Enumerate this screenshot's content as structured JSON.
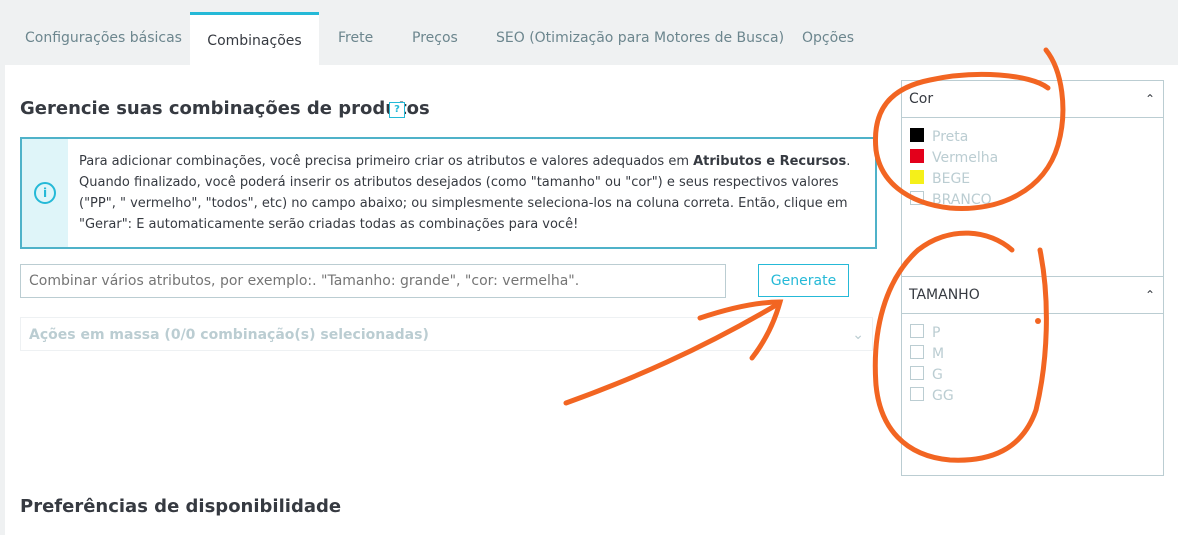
{
  "tabs": [
    {
      "label": "Configurações básicas"
    },
    {
      "label": "Combinações"
    },
    {
      "label": "Frete"
    },
    {
      "label": "Preços"
    },
    {
      "label": "SEO (Otimização para Motores de Busca)"
    },
    {
      "label": "Opções"
    }
  ],
  "main": {
    "title": "Gerencie suas combinações de produtos",
    "help_icon": "?",
    "alert": {
      "icon": "i",
      "text_before": "Para adicionar combinações, você precisa primeiro criar os atributos e valores adequados em ",
      "bold": "Atributos e Recursos",
      "text_after": ". Quando finalizado, você poderá inserir os atributos desejados (como \"tamanho\" ou \"cor\") e seus respectivos valores (\"PP\", \" vermelho\", \"todos\", etc) no campo abaixo; ou simplesmente seleciona-los na coluna correta. Então, clique em \"Gerar\": E automaticamente serão criadas todas as combinações para você!"
    },
    "combine_placeholder": "Combinar vários atributos, por exemplo:. \"Tamanho: grande\", \"cor: vermelha\".",
    "generate_label": "Generate",
    "bulk_actions_label": "Ações em massa (0/0 combinação(s) selecionadas)",
    "availability_title": "Preferências de disponibilidade"
  },
  "attributes": {
    "color": {
      "title": "Cor",
      "items": [
        {
          "label": "Preta",
          "color": "#000000"
        },
        {
          "label": "Vermelha",
          "color": "#e3001b"
        },
        {
          "label": "BEGE",
          "color": "#f5f019"
        },
        {
          "label": "BRANCO",
          "color": "#ffffff"
        }
      ]
    },
    "size": {
      "title": "TAMANHO",
      "items": [
        {
          "label": "P"
        },
        {
          "label": "M"
        },
        {
          "label": "G"
        },
        {
          "label": "GG"
        }
      ]
    }
  },
  "colors": {
    "accent": "#25b9d7",
    "annotation": "#f26522"
  }
}
